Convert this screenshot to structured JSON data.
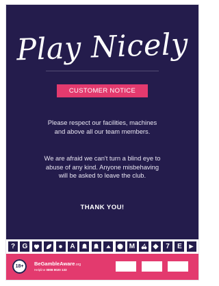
{
  "poster": {
    "title": "Play Nicely",
    "notice_badge": "CUSTOMER NOTICE",
    "paragraph_1": "Please respect our facilities, machines and above all our team members.",
    "paragraph_2": "We are afraid we can't turn a blind eye to abuse of any kind. Anyone misbehaving will be asked to leave the club.",
    "thanks": "THANK YOU!"
  },
  "icon_strip": [
    {
      "type": "letter",
      "text": "?"
    },
    {
      "type": "letter",
      "text": "G"
    },
    {
      "type": "icon",
      "name": "heart-icon"
    },
    {
      "type": "icon",
      "name": "leaf-icon"
    },
    {
      "type": "icon",
      "name": "dot-icon"
    },
    {
      "type": "letter",
      "text": "A"
    },
    {
      "type": "icon",
      "name": "bell-icon"
    },
    {
      "type": "icon",
      "name": "bell-icon"
    },
    {
      "type": "icon",
      "name": "chevron-icon"
    },
    {
      "type": "icon",
      "name": "circle-icon"
    },
    {
      "type": "letter",
      "text": "M"
    },
    {
      "type": "icon",
      "name": "cherry-icon"
    },
    {
      "type": "icon",
      "name": "diamond-icon"
    },
    {
      "type": "letter",
      "text": "7"
    },
    {
      "type": "letter",
      "text": "E"
    },
    {
      "type": "icon",
      "name": "arrow-icon"
    }
  ],
  "footer": {
    "age_badge": "18+",
    "brand_main": "BeGambleAware",
    "brand_domain": ".org",
    "helpline_label": "Helpline",
    "helpline_number": "0808 8020 133",
    "badges": [
      {
        "line1": "",
        "line2": ""
      },
      {
        "line1": "",
        "line2": ""
      },
      {
        "line1": "",
        "line2": ""
      }
    ]
  },
  "colors": {
    "panel": "#241c4c",
    "accent": "#e33a6e",
    "text": "#ffffff"
  }
}
